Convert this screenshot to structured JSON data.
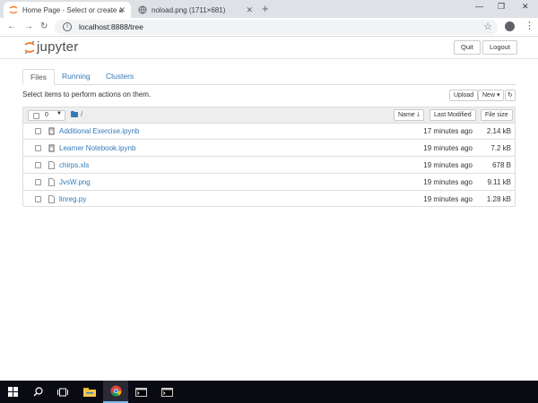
{
  "browser": {
    "tabs": [
      {
        "label": "Home Page - Select or create a n",
        "active": true
      },
      {
        "label": "noload.png (1711×681)",
        "active": false
      }
    ],
    "url": "localhost:8888/tree"
  },
  "jupyter": {
    "logo_text": "jupyter",
    "quit_label": "Quit",
    "logout_label": "Logout",
    "tabs": [
      "Files",
      "Running",
      "Clusters"
    ],
    "actions_text": "Select items to perform actions on them.",
    "upload_label": "Upload",
    "new_label": "New",
    "selected_count": "0",
    "path": "/",
    "columns": {
      "name": "Name",
      "modified": "Last Modified",
      "size": "File size"
    },
    "files": [
      {
        "name": "Additional Exercise.ipynb",
        "modified": "17 minutes ago",
        "size": "2.14 kB",
        "type": "notebook"
      },
      {
        "name": "Learner Notebook.ipynb",
        "modified": "19 minutes ago",
        "size": "7.2 kB",
        "type": "notebook"
      },
      {
        "name": "chirps.xls",
        "modified": "19 minutes ago",
        "size": "678 B",
        "type": "file"
      },
      {
        "name": "JvsW.png",
        "modified": "19 minutes ago",
        "size": "9.11 kB",
        "type": "file"
      },
      {
        "name": "linreg.py",
        "modified": "19 minutes ago",
        "size": "1.28 kB",
        "type": "file"
      }
    ]
  },
  "colors": {
    "link": "#337ab7",
    "jupyter_orange": "#f37726",
    "taskbar": "#0a0a12"
  }
}
